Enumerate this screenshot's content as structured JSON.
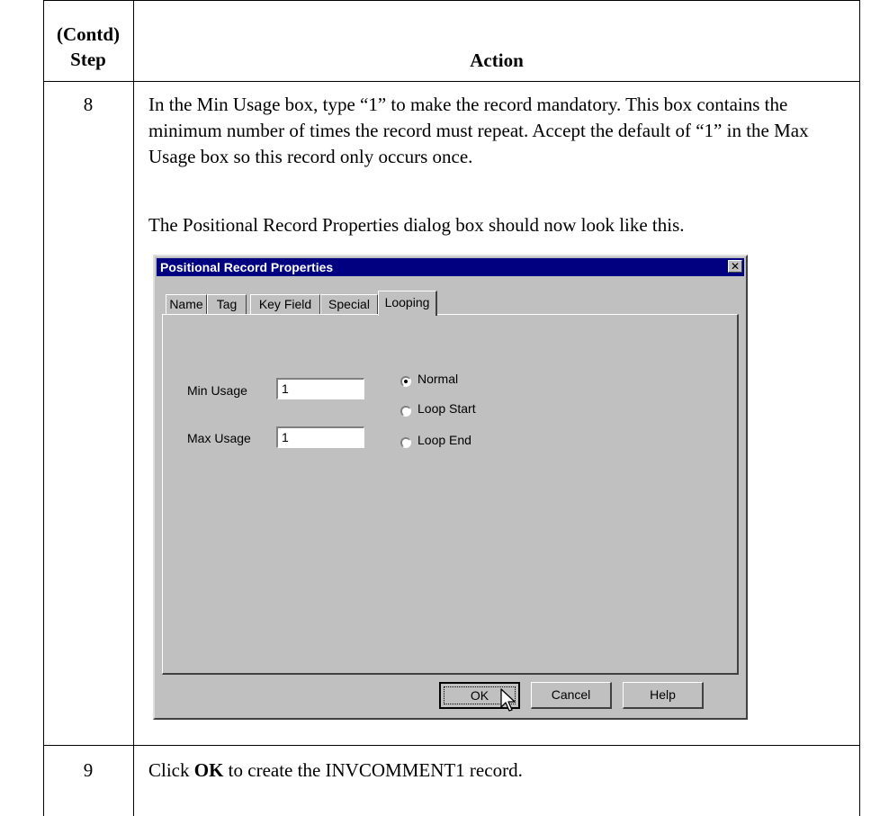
{
  "table": {
    "header": {
      "step_line1": "(Contd)",
      "step_line2": "Step",
      "action": "Action"
    },
    "rows": [
      {
        "step": "8",
        "para1": "In the Min Usage box, type “1” to make the record mandatory. This box contains the minimum number of times the record must repeat. Accept the default of “1” in the Max Usage box so this record only occurs once.",
        "para2": "The Positional Record Properties dialog box should now look like this."
      },
      {
        "step": "9",
        "pre": "Click ",
        "bold": "OK",
        "post": " to create the INVCOMMENT1 record."
      }
    ]
  },
  "dialog": {
    "title": "Positional Record Properties",
    "close_label": "✕",
    "tabs": [
      "Name",
      "Tag",
      "Key Field",
      "Special",
      "Looping"
    ],
    "active_tab": "Looping",
    "min_usage": {
      "label": "Min Usage",
      "value": "1"
    },
    "max_usage": {
      "label": "Max Usage",
      "value": "1"
    },
    "radios": [
      {
        "label": "Normal",
        "checked": true
      },
      {
        "label": "Loop Start",
        "checked": false
      },
      {
        "label": "Loop End",
        "checked": false
      }
    ],
    "buttons": {
      "ok": "OK",
      "cancel": "Cancel",
      "help": "Help"
    }
  },
  "icons": {
    "cursor": "mouse-pointer-icon",
    "close": "close-icon"
  },
  "colors": {
    "titlebar": "#000080",
    "dialog_face": "#c0c0c0"
  }
}
